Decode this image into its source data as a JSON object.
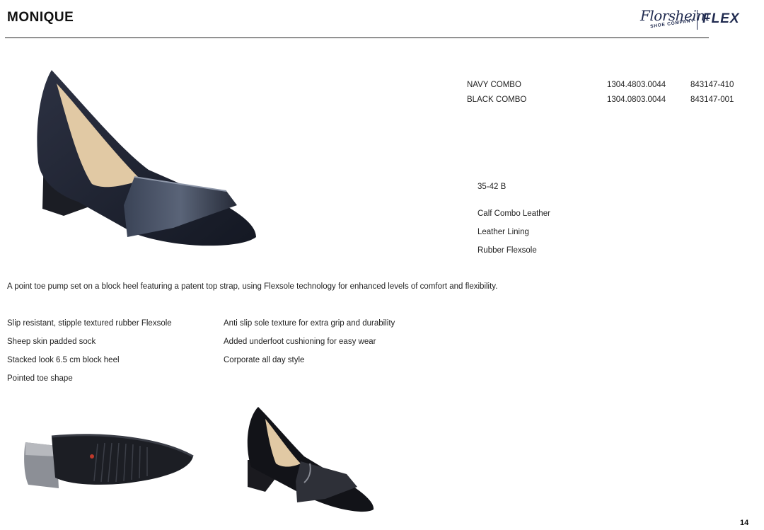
{
  "header": {
    "title": "MONIQUE"
  },
  "brand": {
    "script": "Florsheim",
    "sub": "SHOE COMPANY",
    "flex": "FLEX",
    "color": "#1f2a4f"
  },
  "colorways": [
    {
      "name": "NAVY COMBO",
      "code": "1304.4803.0044",
      "ref": "843147-410"
    },
    {
      "name": "BLACK COMBO",
      "code": "1304.0803.0044",
      "ref": "843147-001"
    }
  ],
  "specs": {
    "sizes": "35-42 B",
    "upper": "Calf Combo Leather",
    "lining": "Leather Lining",
    "sole": "Rubber Flexsole"
  },
  "description": "A point toe pump set on a block heel featuring a patent top strap, using Flexsole technology for enhanced levels of comfort and flexibility.",
  "features_left": [
    "Slip resistant, stipple textured rubber Flexsole",
    "Sheep skin padded sock",
    "Stacked look 6.5 cm block heel",
    "Pointed toe shape"
  ],
  "features_right": [
    "Anti slip sole texture for extra grip and durability",
    "Added underfoot cushioning for easy wear",
    "Corporate all day style"
  ],
  "images": {
    "hero": "navy-pump-side-view",
    "sole": "shoe-sole-view",
    "angle": "black-pump-three-quarter-view"
  },
  "page": {
    "number": "14"
  }
}
